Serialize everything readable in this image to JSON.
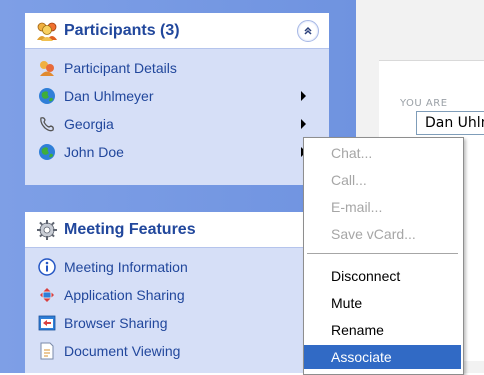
{
  "participants_panel": {
    "title": "Participants (3)",
    "items": [
      {
        "label": "Participant Details",
        "icon": "participants-details-icon"
      },
      {
        "label": "Dan Uhlmeyer",
        "icon": "globe-icon"
      },
      {
        "label": "Georgia",
        "icon": "phone-icon"
      },
      {
        "label": "John Doe",
        "icon": "globe-icon"
      }
    ]
  },
  "features_panel": {
    "title": "Meeting Features",
    "items": [
      {
        "label": "Meeting Information",
        "icon": "info-icon"
      },
      {
        "label": "Application Sharing",
        "icon": "application-sharing-icon"
      },
      {
        "label": "Browser Sharing",
        "icon": "browser-sharing-icon"
      },
      {
        "label": "Document Viewing",
        "icon": "document-icon"
      }
    ]
  },
  "right_pane": {
    "you_are_label": "YOU ARE",
    "user_value": "Dan Uhlmeyer"
  },
  "context_menu": {
    "disabled_items": [
      "Chat...",
      "Call...",
      "E-mail...",
      "Save vCard..."
    ],
    "enabled_items": [
      "Disconnect",
      "Mute",
      "Rename",
      "Associate"
    ],
    "highlighted": "Associate"
  },
  "colors": {
    "panel_bg": "#d6dff7",
    "sidebar_bg": "#7e9fe6",
    "title_color": "#21479c",
    "menu_highlight": "#316ac5"
  }
}
